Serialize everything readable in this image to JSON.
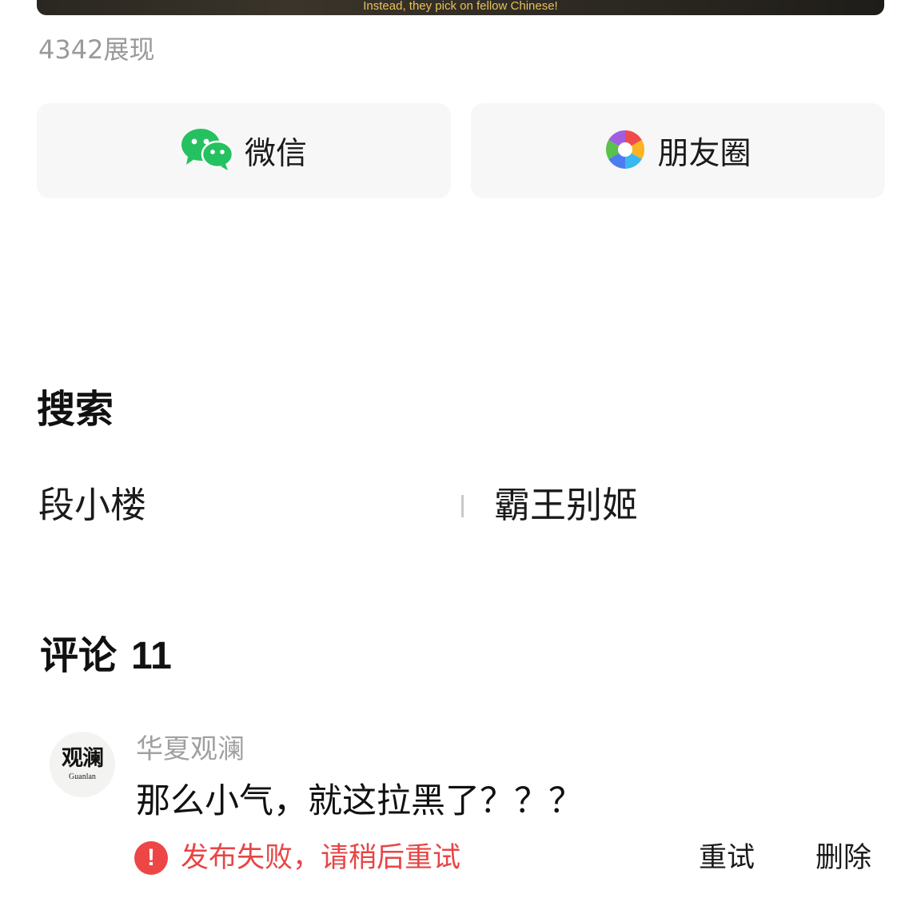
{
  "video": {
    "caption": "Instead, they pick on fellow Chinese!"
  },
  "stats": {
    "impressions": "4342展现"
  },
  "share": {
    "wechat_label": "微信",
    "moments_label": "朋友圈",
    "wechat_icon": "wechat-icon",
    "moments_icon": "moments-aperture-icon",
    "wechat_color": "#25c160"
  },
  "search": {
    "title": "搜索",
    "terms": [
      "段小楼",
      "霸王别姬"
    ]
  },
  "comments": {
    "title": "评论",
    "count": "11",
    "items": [
      {
        "author": "华夏观澜",
        "avatar_text": "观澜",
        "avatar_subtext": "Guanlan",
        "text": "那么小气，就这拉黑了？？？",
        "status": "发布失败，请稍后重试",
        "status_icon": "!",
        "retry_label": "重试",
        "delete_label": "删除"
      }
    ]
  },
  "colors": {
    "error": "#e84545",
    "muted_text": "#9a9a9a",
    "button_bg": "#f7f7f7"
  }
}
